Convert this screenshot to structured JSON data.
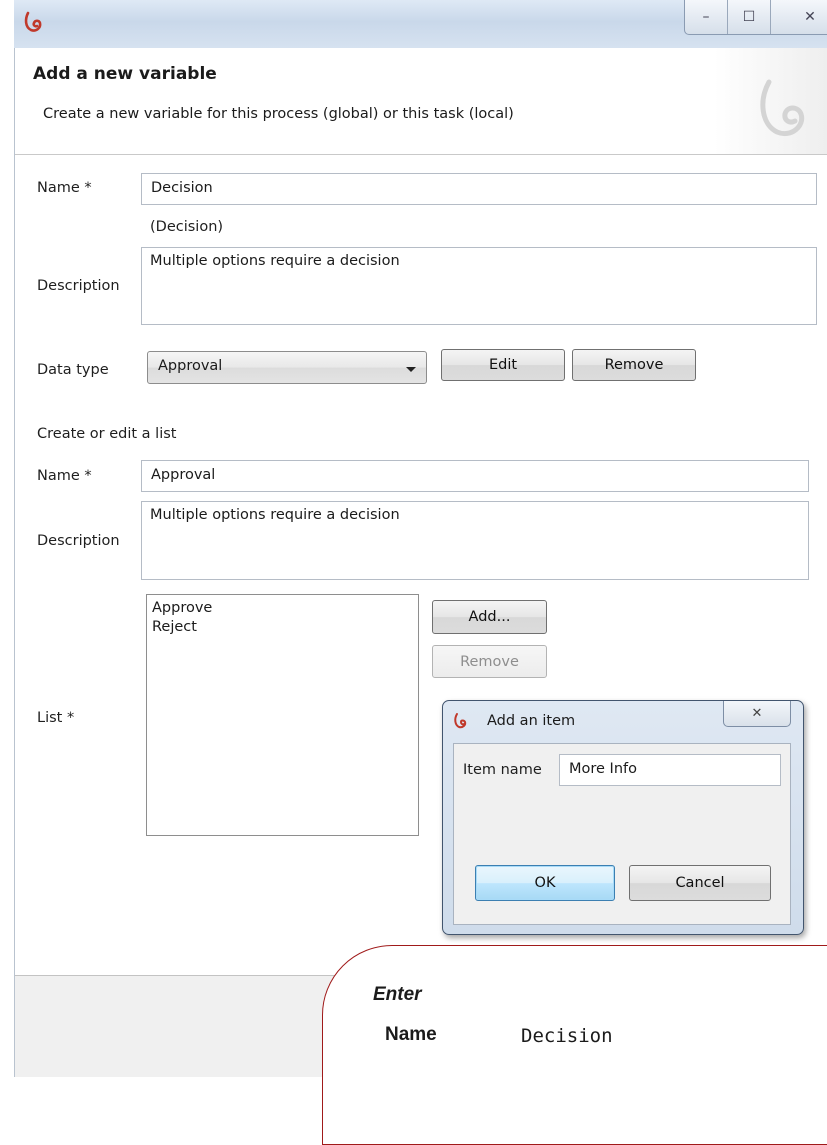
{
  "window": {
    "controls": {
      "minimize": "–",
      "maximize": "☐",
      "close": "✕"
    }
  },
  "header": {
    "title": "Add a new variable",
    "subtitle": "Create a new variable for this process (global) or this task (local)"
  },
  "variable": {
    "name_label": "Name *",
    "name_value": "Decision",
    "name_hint": "(Decision)",
    "description_label": "Description",
    "description_value": "Multiple options require a decision",
    "data_type_label": "Data type",
    "data_type_value": "Approval",
    "edit_label": "Edit",
    "remove_label": "Remove"
  },
  "list_editor": {
    "section_label": "Create or edit a list",
    "name_label": "Name *",
    "name_value": "Approval",
    "description_label": "Description",
    "description_value": "Multiple options require a decision",
    "list_label": "List *",
    "items": [
      "Approve",
      "Reject"
    ],
    "add_label": "Add...",
    "remove_label": "Remove"
  },
  "dialog": {
    "title": "Add an item",
    "close": "✕",
    "item_label": "Item name",
    "item_value": "More Info",
    "ok_label": "OK",
    "cancel_label": "Cancel"
  },
  "callout": {
    "heading": "Enter",
    "field": "Name",
    "value": "Decision"
  },
  "colors": {
    "accent": "#c0392b",
    "callout_border": "#a01a1a",
    "primary_button": "#bee6fd"
  }
}
